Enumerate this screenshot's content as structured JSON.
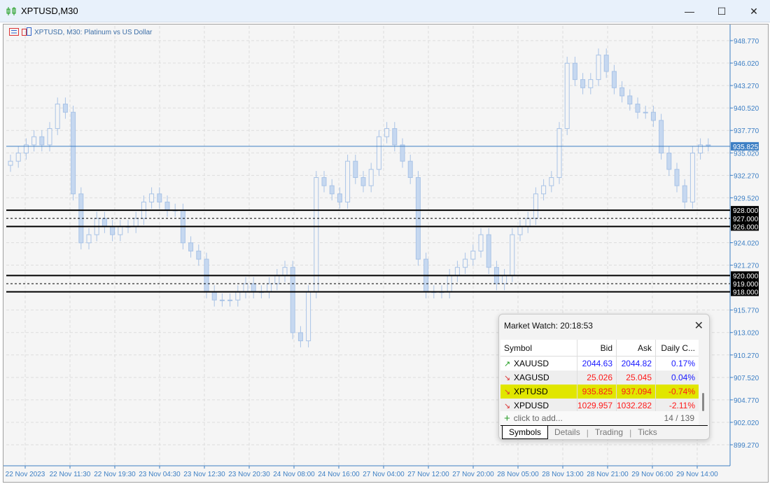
{
  "window": {
    "title": "XPTUSD,M30",
    "minimize": "—",
    "maximize": "☐",
    "close": "✕"
  },
  "chart": {
    "label": "XPTUSD, M30:  Platinum vs US Dollar",
    "colors": {
      "candle": "#a9c3e6",
      "axis": "#3d7fc4",
      "level": "#000000",
      "current": "#3d7fc4"
    }
  },
  "chart_data": {
    "type": "candlestick",
    "symbol": "XPTUSD",
    "timeframe": "M30",
    "ylim": [
      898.0,
      950.5
    ],
    "y_ticks": [
      "948.770",
      "946.020",
      "943.270",
      "940.520",
      "937.770",
      "935.020",
      "932.270",
      "929.520",
      "924.020",
      "921.270",
      "915.770",
      "913.020",
      "910.270",
      "907.520",
      "904.770",
      "902.020",
      "899.270"
    ],
    "x_ticks": [
      "22 Nov 2023",
      "22 Nov 11:30",
      "22 Nov 19:30",
      "23 Nov 04:30",
      "23 Nov 12:30",
      "23 Nov 20:30",
      "24 Nov 08:00",
      "24 Nov 16:00",
      "27 Nov 04:00",
      "27 Nov 12:00",
      "27 Nov 20:00",
      "28 Nov 05:00",
      "28 Nov 13:00",
      "28 Nov 21:00",
      "29 Nov 06:00",
      "29 Nov 14:00"
    ],
    "closes": [
      934,
      935,
      936,
      937,
      936,
      938,
      941,
      940,
      930,
      924,
      925,
      927,
      926,
      925,
      926,
      926,
      927,
      929,
      930,
      929,
      928,
      928,
      924,
      923,
      922,
      918,
      917,
      917,
      917,
      918,
      919,
      918,
      918,
      919,
      920,
      921,
      913,
      912,
      918,
      932,
      931,
      930,
      929,
      934,
      932,
      931,
      933,
      937,
      938,
      936,
      934,
      932,
      922,
      918,
      918,
      918,
      920,
      921,
      922,
      923,
      925,
      921,
      919,
      920,
      925,
      926,
      927,
      930,
      931,
      932,
      938,
      946,
      944,
      943,
      944,
      947,
      945,
      943,
      942,
      941,
      940,
      940,
      939,
      935,
      933,
      931,
      929,
      935,
      936,
      936
    ],
    "current_price": {
      "label": "935.825",
      "value": 935.825
    },
    "levels": [
      {
        "label": "928.000",
        "value": 928,
        "style": "solid"
      },
      {
        "label": "927.000",
        "value": 927,
        "style": "dashed"
      },
      {
        "label": "926.000",
        "value": 926,
        "style": "solid"
      },
      {
        "label": "920.000",
        "value": 920,
        "style": "solid"
      },
      {
        "label": "919.000",
        "value": 919,
        "style": "dashed"
      },
      {
        "label": "918.000",
        "value": 918,
        "style": "solid"
      }
    ]
  },
  "market_watch": {
    "title": "Market Watch: 20:18:53",
    "columns": [
      "Symbol",
      "Bid",
      "Ask",
      "Daily C..."
    ],
    "rows": [
      {
        "dir": "up",
        "arrow": "↗",
        "symbol": "XAUUSD",
        "bid": "2044.63",
        "ask": "2044.82",
        "change": "0.17%",
        "color": "#1a1aff",
        "changeColor": "#1a1aff",
        "selected": false
      },
      {
        "dir": "down",
        "arrow": "↘",
        "symbol": "XAGUSD",
        "bid": "25.026",
        "ask": "25.045",
        "change": "0.04%",
        "color": "#ff1a1a",
        "changeColor": "#1a1aff",
        "selected": false
      },
      {
        "dir": "down",
        "arrow": "↘",
        "symbol": "XPTUSD",
        "bid": "935.825",
        "ask": "937.094",
        "change": "-0.74%",
        "color": "#ff1a1a",
        "changeColor": "#ff1a1a",
        "selected": true
      },
      {
        "dir": "down",
        "arrow": "↘",
        "symbol": "XPDUSD",
        "bid": "1029.957",
        "ask": "1032.282",
        "change": "-2.11%",
        "color": "#ff1a1a",
        "changeColor": "#ff1a1a",
        "selected": false
      }
    ],
    "add_label": "click to add...",
    "count": "14 / 139",
    "tabs": [
      "Symbols",
      "Details",
      "Trading",
      "Ticks"
    ]
  }
}
